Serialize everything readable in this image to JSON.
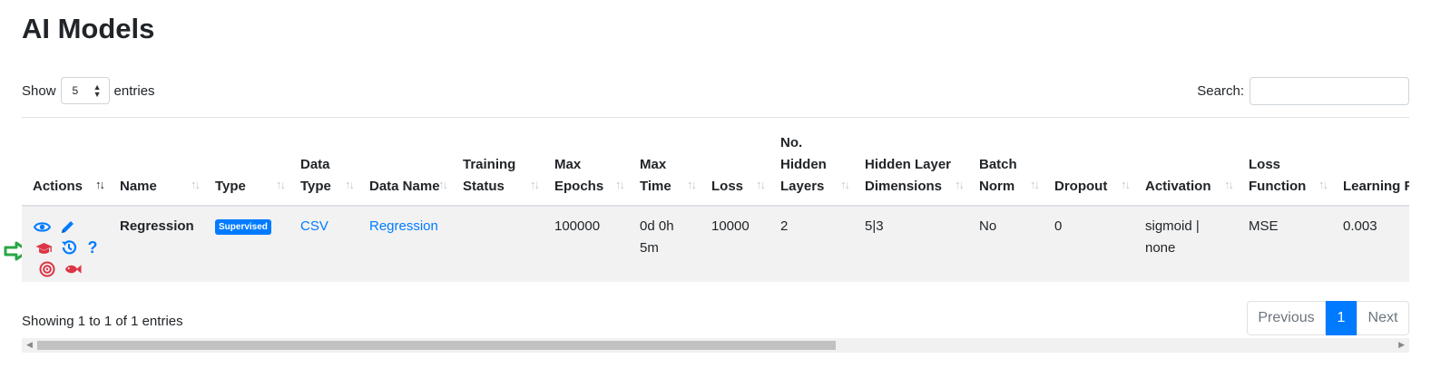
{
  "page_title": "AI Models",
  "length_menu": {
    "show_label": "Show",
    "value": "5",
    "entries_label": "entries"
  },
  "search": {
    "label": "Search:",
    "value": ""
  },
  "table": {
    "headers": {
      "actions": "Actions",
      "name": "Name",
      "type": "Type",
      "data_type": "Data Type",
      "data_name": "Data Name",
      "training_status": "Training Status",
      "max_epochs": "Max Epochs",
      "max_time": "Max Time",
      "loss": "Loss",
      "no_hidden_layers": "No. Hidden Layers",
      "hidden_layer_dimensions": "Hidden Layer Dimensions",
      "batch_norm": "Batch Norm",
      "dropout": "Dropout",
      "activation": "Activation",
      "loss_function": "Loss Function",
      "learning_rate": "Learning Rate"
    },
    "rows": [
      {
        "name": "Regression",
        "type": "Supervised",
        "data_type": "CSV",
        "data_name": "Regression",
        "training_status": "",
        "max_epochs": "100000",
        "max_time": "0d 0h 5m",
        "loss": "10000",
        "no_hidden_layers": "2",
        "hidden_layer_dimensions": "5|3",
        "batch_norm": "No",
        "dropout": "0",
        "activation": "sigmoid | none",
        "loss_function": "MSE",
        "learning_rate": "0.003"
      }
    ]
  },
  "action_icons": [
    "eye-icon",
    "pencil-icon",
    "graduation-cap-icon",
    "history-icon",
    "question-icon",
    "target-icon",
    "fish-icon"
  ],
  "colors": {
    "primary": "#007bff",
    "danger": "#dc3545",
    "indicator": "#28a745",
    "row_bg": "#f2f2f2"
  },
  "info_text": "Showing 1 to 1 of 1 entries",
  "pagination": {
    "previous": "Previous",
    "current": "1",
    "next": "Next"
  }
}
